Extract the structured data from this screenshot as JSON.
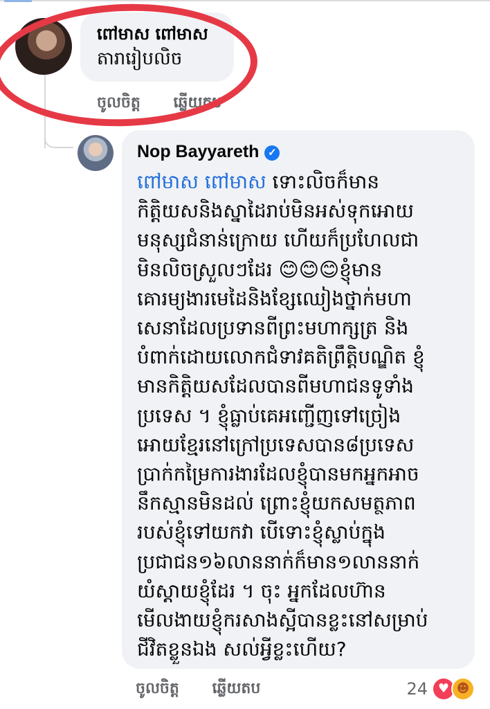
{
  "first_comment": {
    "author": "ពៅមាស ពៅមាស",
    "text": "តារារៀបលិច",
    "actions": {
      "like": "ចូលចិត្ត",
      "reply": "ឆ្លើយតប"
    }
  },
  "reply_comment": {
    "author": "Nop Bayyareth",
    "verified_icon": "verified-badge-icon",
    "mention": "ពៅមាស ពៅមាស",
    "lines": [
      "ទោះលិចក៏មាន",
      "កិត្តិយសនិងស្នាដៃរាប់មិនអស់ទុកអោយ",
      "មនុស្សជំនាន់ក្រោយ ហើយក៏ប្រហែលជា",
      "មិនលិចស្រួលៗដែរ 😊😊😊ខ្ញុំមាន",
      "គោរម្យងារមេដៃនិងខ្សែឈៀងថ្នាក់មហា",
      "សេនាដែលប្រទានពីព្រះមហាក្សត្រ និង",
      "បំពាក់ដោយលោកជំទាវគតិព្រឹត្តិបណ្ឌិត ខ្ញុំ",
      "មានកិត្តិយសដែលបានពីមហាជនទូទាំង",
      "ប្រទេស ។ ខ្ញុំធ្លាប់គេអញ្ជើញទៅច្រៀង",
      "អោយខ្មែរនៅក្រៅប្រទេសបាន៨ប្រទេស",
      "ប្រាក់កម្រៃការងារដែលខ្ញុំបានមកអ្នកអាច",
      "នឹកស្មានមិនដល់ ព្រោះខ្ញុំយកសមត្ថភាព",
      "របស់ខ្ញុំទៅយកវា បើទោះខ្ញុំស្លាប់ក្នុង",
      "ប្រជាជន១៦លាននាក់ក៏មាន១លាននាក់",
      "យំស្តាយខ្ញុំដែរ ។ ចុះ អ្នកដែលហ៊ាន",
      "មើលងាយខ្ញុំករសាងស្អីបានខ្លះនៅសម្រាប់",
      "ជីវិតខ្លួនឯង សល់អ្វីខ្លះហើយ?"
    ],
    "actions": {
      "like": "ចូលចិត្ត",
      "reply": "ឆ្លើយតប"
    },
    "reactions": {
      "count": "24",
      "icons": [
        "heart-icon",
        "care-icon"
      ]
    }
  },
  "colors": {
    "bubble": "#f0f2f5",
    "mention": "#216fdb",
    "verified": "#1877f2",
    "annotation": "#e63946",
    "meta_text": "#65676b"
  }
}
